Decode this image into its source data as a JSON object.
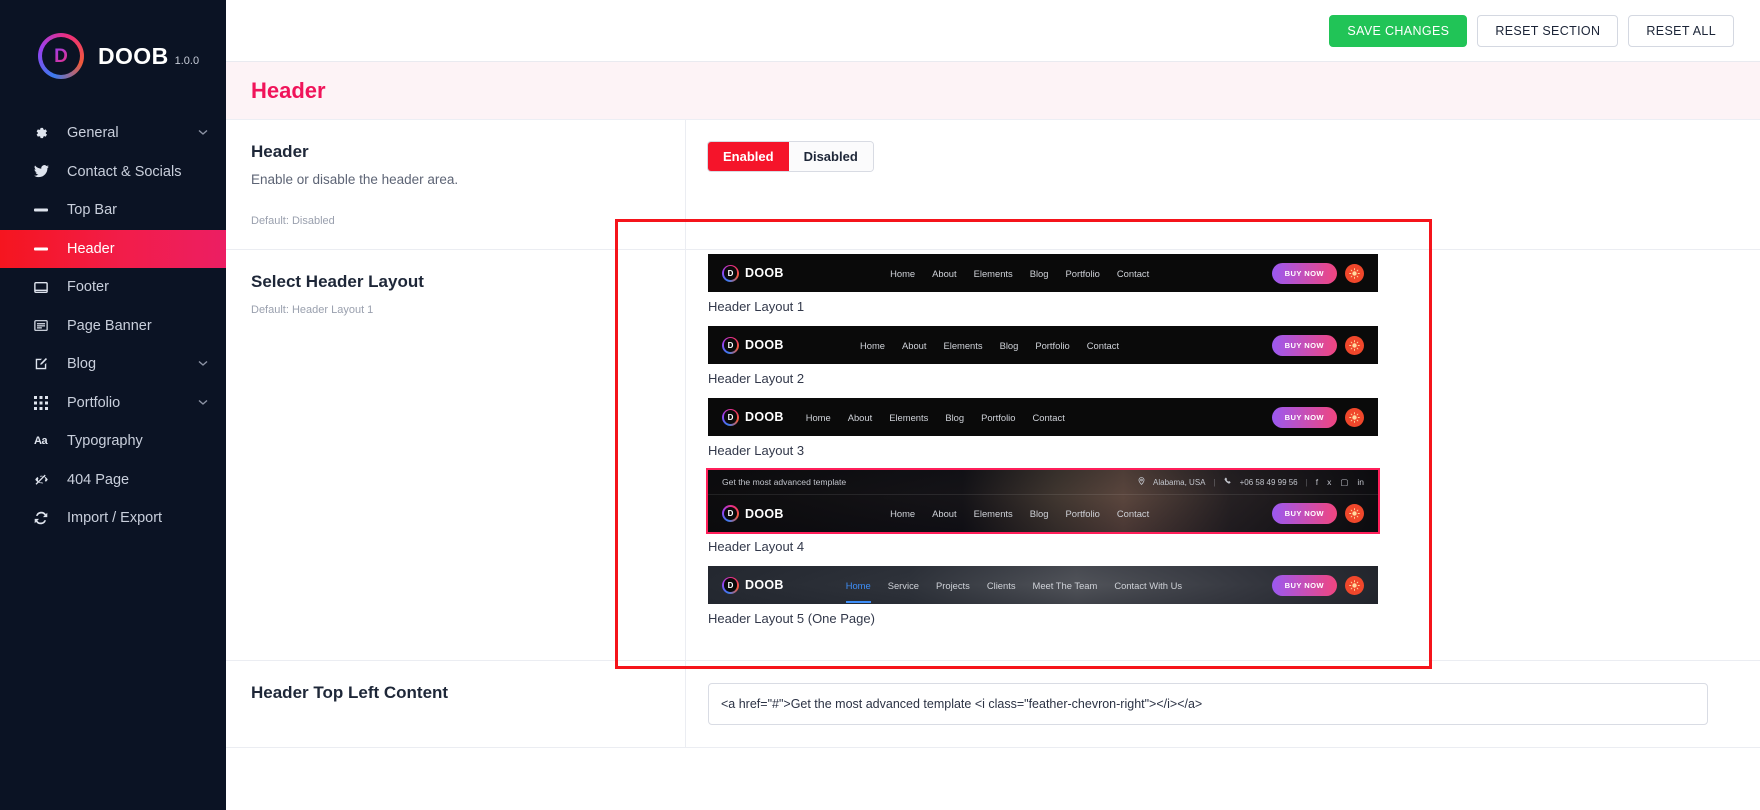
{
  "brand": {
    "name": "DOOB",
    "version": "1.0.0",
    "mark_letter": "D"
  },
  "sidebar": {
    "items": [
      {
        "label": "General",
        "icon": "gear-icon",
        "expandable": true,
        "active": false
      },
      {
        "label": "Contact & Socials",
        "icon": "twitter-bird-icon",
        "expandable": false,
        "active": false
      },
      {
        "label": "Top Bar",
        "icon": "minus-bar-icon",
        "expandable": false,
        "active": false
      },
      {
        "label": "Header",
        "icon": "minus-bar-icon",
        "expandable": false,
        "active": true
      },
      {
        "label": "Footer",
        "icon": "window-icon",
        "expandable": false,
        "active": false
      },
      {
        "label": "Page Banner",
        "icon": "banner-icon",
        "expandable": false,
        "active": false
      },
      {
        "label": "Blog",
        "icon": "pencil-square-icon",
        "expandable": true,
        "active": false
      },
      {
        "label": "Portfolio",
        "icon": "grid-dots-icon",
        "expandable": true,
        "active": false
      },
      {
        "label": "Typography",
        "icon": "text-aa-icon",
        "expandable": false,
        "active": false
      },
      {
        "label": "404 Page",
        "icon": "eye-slash-icon",
        "expandable": false,
        "active": false
      },
      {
        "label": "Import / Export",
        "icon": "refresh-icon",
        "expandable": false,
        "active": false
      }
    ]
  },
  "toolbar": {
    "save_label": "SAVE CHANGES",
    "reset_section_label": "RESET SECTION",
    "reset_all_label": "RESET ALL",
    "save_color": "#21c457"
  },
  "page": {
    "title": "Header",
    "title_color": "#f0145a"
  },
  "fields": {
    "header_toggle": {
      "title": "Header",
      "description": "Enable or disable the header area.",
      "default_text": "Default: Disabled",
      "options": [
        "Enabled",
        "Disabled"
      ],
      "selected": "Enabled"
    },
    "select_layout": {
      "title": "Select Header Layout",
      "default_text": "Default: Header Layout 1",
      "selected": "Header Layout 4"
    },
    "top_left_content": {
      "title": "Header Top Left Content",
      "value": "<a href=\"#\">Get the most advanced template <i class=\"feather-chevron-right\"></i></a>"
    }
  },
  "layouts": [
    {
      "caption": "Header Layout 1",
      "nav": [
        "Home",
        "About",
        "Elements",
        "Blog",
        "Portfolio",
        "Contact"
      ],
      "buy_label": "BUY NOW",
      "align": "right",
      "selected": false
    },
    {
      "caption": "Header Layout 2",
      "nav": [
        "Home",
        "About",
        "Elements",
        "Blog",
        "Portfolio",
        "Contact"
      ],
      "buy_label": "BUY NOW",
      "align": "center",
      "selected": false
    },
    {
      "caption": "Header Layout 3",
      "nav": [
        "Home",
        "About",
        "Elements",
        "Blog",
        "Portfolio",
        "Contact"
      ],
      "buy_label": "BUY NOW",
      "align": "left",
      "selected": false
    },
    {
      "caption": "Header Layout 4",
      "nav": [
        "Home",
        "About",
        "Elements",
        "Blog",
        "Portfolio",
        "Contact"
      ],
      "buy_label": "BUY NOW",
      "align": "right",
      "selected": true,
      "topbar": {
        "promo": "Get the most advanced template",
        "location": "Alabama, USA",
        "phone": "+06 58 49 99 56"
      }
    },
    {
      "caption": "Header Layout 5 (One Page)",
      "nav": [
        "Home",
        "Service",
        "Projects",
        "Clients",
        "Meet The Team",
        "Contact With Us"
      ],
      "current_nav": "Home",
      "buy_label": "BUY NOW",
      "align": "center-left",
      "selected": false
    }
  ]
}
